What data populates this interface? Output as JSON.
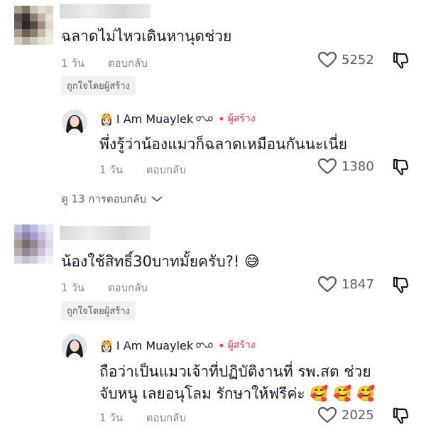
{
  "comments": [
    {
      "text": "ฉลาดไม่ไหวเดินหานุดช่วย",
      "time": "1 วัน",
      "reply_label": "ตอบกลับ",
      "likes": "5252",
      "badge": "ถูกใจโดยผู้สร้าง",
      "reply": {
        "author": "I Am Muaylek",
        "creator_label": "ผู้สร้าง",
        "lines": [
          "พึ่งรู้ว่าน้องแมวก็ฉลาดเหมือนกันนะเนี่ย"
        ],
        "time": "1 วัน",
        "reply_label": "ตอบกลับ",
        "likes": "1380"
      },
      "view_more": "ดู 13 การตอบกลับ"
    },
    {
      "text": "น้องใช้สิทธิ์30บาทมั้ยครับ?!",
      "emoji": "😅",
      "time": "1 วัน",
      "reply_label": "ตอบกลับ",
      "likes": "1847",
      "badge": "ถูกใจโดยผู้สร้าง",
      "reply": {
        "author": "I Am Muaylek",
        "creator_label": "ผู้สร้าง",
        "lines": [
          "ถือว่าเป็นแมวเจ้าที่ปฏิบัติงานที่ รพ.สต ช่วย",
          "จับหนู เลยอนุโลม รักษาให้ฟรีค่ะ"
        ],
        "emoji": "🥰 🥰 🥰",
        "time": "1 วัน",
        "reply_label": "ตอบกลับ",
        "likes": "2025"
      }
    }
  ],
  "icons": {
    "like": "heart-outline-icon",
    "dislike": "thumbs-down-icon",
    "crown": "crown-icon",
    "link": "infinity-icon"
  },
  "colors": {
    "creator_accent": "#fe2c55",
    "meta": "#8a8b91",
    "badge_bg": "#f1f1f2"
  }
}
